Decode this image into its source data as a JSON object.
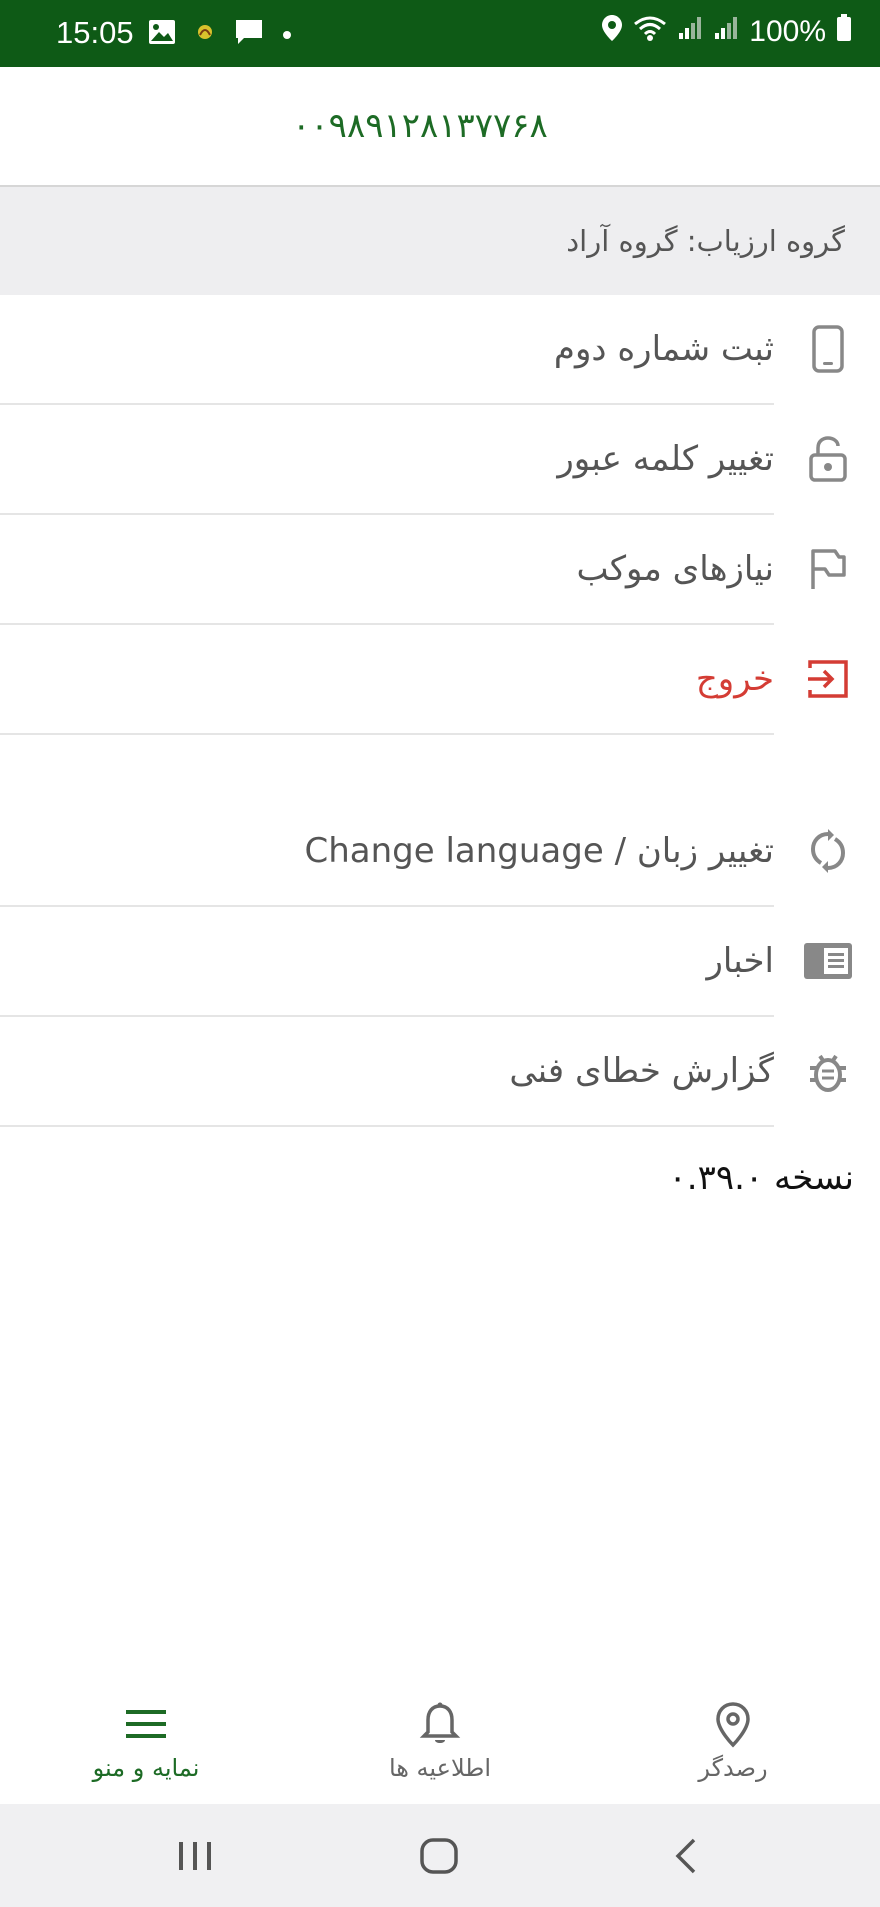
{
  "status_bar": {
    "time": "15:05",
    "battery": "100%",
    "left_icons": [
      "image-icon",
      "app-notification-icon",
      "message-icon",
      "dot-icon"
    ],
    "right_icons": [
      "location-icon",
      "wifi-icon",
      "signal-icon",
      "signal-icon",
      "battery-icon"
    ]
  },
  "header": {
    "phone_number": "۰۰۹۸۹۱۲۸۱۳۷۷۶۸"
  },
  "group": {
    "label": "گروه ارزیاب: گروه آراد"
  },
  "menu_primary": [
    {
      "label": "ثبت شماره دوم",
      "icon": "phone-icon"
    },
    {
      "label": "تغییر کلمه عبور",
      "icon": "lock-icon"
    },
    {
      "label": "نیازهای موکب",
      "icon": "flag-icon"
    },
    {
      "label": "خروج",
      "icon": "logout-icon"
    }
  ],
  "menu_secondary": [
    {
      "label": "تغییر زبان / Change language",
      "icon": "refresh-icon"
    },
    {
      "label": "اخبار",
      "icon": "news-icon"
    },
    {
      "label": "گزارش خطای فنی",
      "icon": "bug-icon"
    }
  ],
  "version": {
    "label": "نسخه ۰.۳۹.۰"
  },
  "bottom_nav": {
    "items": [
      {
        "label": "نمایه و منو",
        "icon": "menu-icon",
        "active": true
      },
      {
        "label": "اطلاعیه ها",
        "icon": "bell-icon",
        "active": false
      },
      {
        "label": "رصدگر",
        "icon": "location-pin-icon",
        "active": false
      }
    ]
  },
  "colors": {
    "status_bar": "#0e5a16",
    "accent": "#1d6b25",
    "logout": "#d43c34",
    "group_bg": "#eeeef0"
  }
}
